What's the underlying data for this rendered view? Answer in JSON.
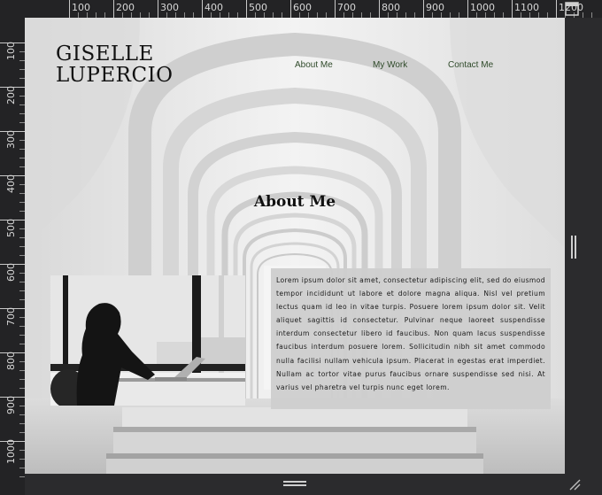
{
  "ruler": {
    "top_labels": [
      "100",
      "200",
      "300",
      "400",
      "500",
      "600",
      "700",
      "800",
      "900",
      "1000",
      "1100",
      "1200"
    ],
    "left_labels": [
      "100",
      "200",
      "300",
      "400",
      "500",
      "600",
      "700",
      "800",
      "900",
      "1000"
    ]
  },
  "site": {
    "brand_line1": "GISELLE",
    "brand_line2": "LUPERCIO",
    "nav": [
      "About Me",
      "My Work",
      "Contact Me"
    ],
    "section_title": "About Me",
    "body_text": "Lorem ipsum dolor sit amet, consectetur adipiscing elit, sed do eiusmod tempor incididunt ut labore et dolore magna aliqua. Nisl vel pretium lectus quam id leo in vitae turpis. Posuere lorem ipsum dolor sit. Velit aliquet sagittis id consectetur. Pulvinar neque laoreet suspendisse interdum consectetur libero id faucibus. Non quam lacus suspendisse faucibus interdum posuere lorem. Sollicitudin nibh sit amet commodo nulla facilisi nullam vehicula ipsum. Placerat in egestas erat imperdiet. Nullam ac tortor vitae purus faucibus ornare suspendisse sed nisi. At varius vel pharetra vel turpis nunc eget lorem."
  },
  "icons": {
    "corner": "frame-corner-icon",
    "resize": "resize-grip-icon",
    "v_handle": "vertical-drag-handle-icon",
    "h_handle": "horizontal-drag-handle-icon"
  },
  "colors": {
    "editor_bg": "#2b2b2d",
    "nav_text": "#2f4a2a",
    "textbox_bg": "#cfcfcf"
  }
}
